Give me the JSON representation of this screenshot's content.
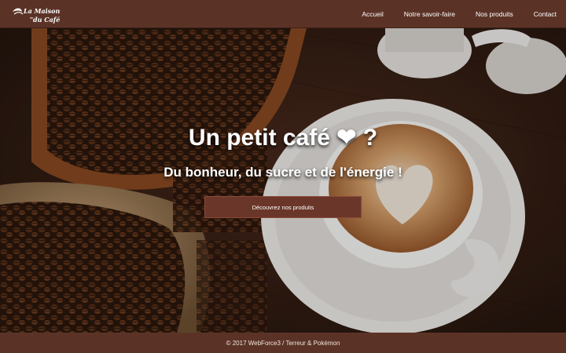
{
  "header": {
    "logo_text_top": "La Maison",
    "logo_text_bottom": "du Café",
    "nav": [
      {
        "label": "Accueil"
      },
      {
        "label": "Notre savoir-faire"
      },
      {
        "label": "Nos produits"
      },
      {
        "label": "Contact"
      }
    ]
  },
  "hero": {
    "title": "Un petit café ❤ ?",
    "subtitle": "Du bonheur, du sucre et de l'énergie !",
    "cta_label": "Découvrez nos produits"
  },
  "footer": {
    "text": "© 2017 WebForce3 / Terreur & Pokémon"
  },
  "colors": {
    "header_bg": "#5b3326",
    "button_bg": "#6a3629",
    "footer_bg": "#5b3326"
  }
}
